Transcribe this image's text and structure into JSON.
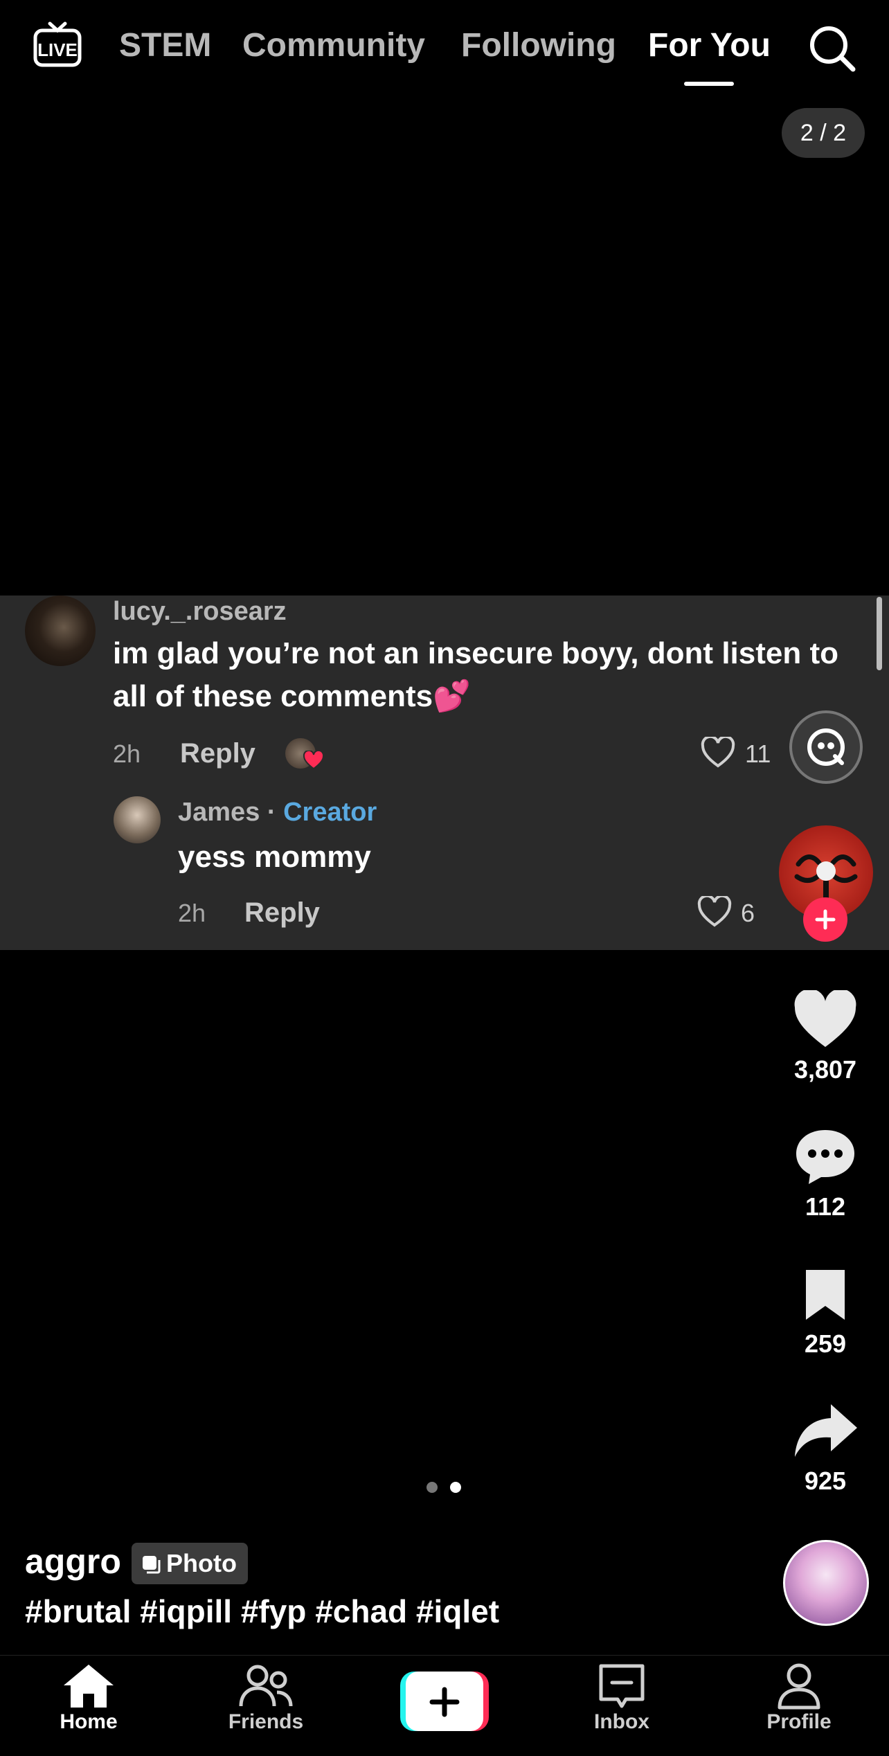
{
  "top_nav": {
    "live_label": "LIVE",
    "tabs": [
      {
        "label": "STEM",
        "active": false
      },
      {
        "label": "Community",
        "active": false
      },
      {
        "label": "Following",
        "active": false
      },
      {
        "label": "For You",
        "active": true
      }
    ],
    "search_icon": "search-icon"
  },
  "pager": "2 / 2",
  "comment": {
    "username": "lucy._.rosearz",
    "text_line1": "im glad you’re not an insecure boyy, dont listen to",
    "text_line2": "all of these comments💕",
    "time": "2h",
    "reply_label": "Reply",
    "likes": "11",
    "reply": {
      "username": "James",
      "separator": " · ",
      "badge": "Creator",
      "text": "yess mommy",
      "time": "2h",
      "reply_label": "Reply",
      "likes": "6"
    }
  },
  "right_rail": {
    "like_count": "3,807",
    "comment_count": "112",
    "bookmark_count": "259",
    "share_count": "925"
  },
  "post": {
    "creator": "aggro",
    "badge": "Photo",
    "hashtags": "#brutal #iqpill #fyp #chad #iqlet",
    "carousel": {
      "total": 2,
      "current": 2
    }
  },
  "bottom_nav": [
    {
      "label": "Home",
      "icon": "home-icon",
      "active": true
    },
    {
      "label": "Friends",
      "icon": "friends-icon",
      "active": false
    },
    {
      "label": "",
      "icon": "create-plus-icon",
      "active": false
    },
    {
      "label": "Inbox",
      "icon": "inbox-icon",
      "active": false
    },
    {
      "label": "Profile",
      "icon": "profile-icon",
      "active": false
    }
  ],
  "colors": {
    "creator_badge": "#5aa9e0",
    "follow_plus": "#fe2c55",
    "create_left": "#25f4ee",
    "create_right": "#fe2c55"
  }
}
